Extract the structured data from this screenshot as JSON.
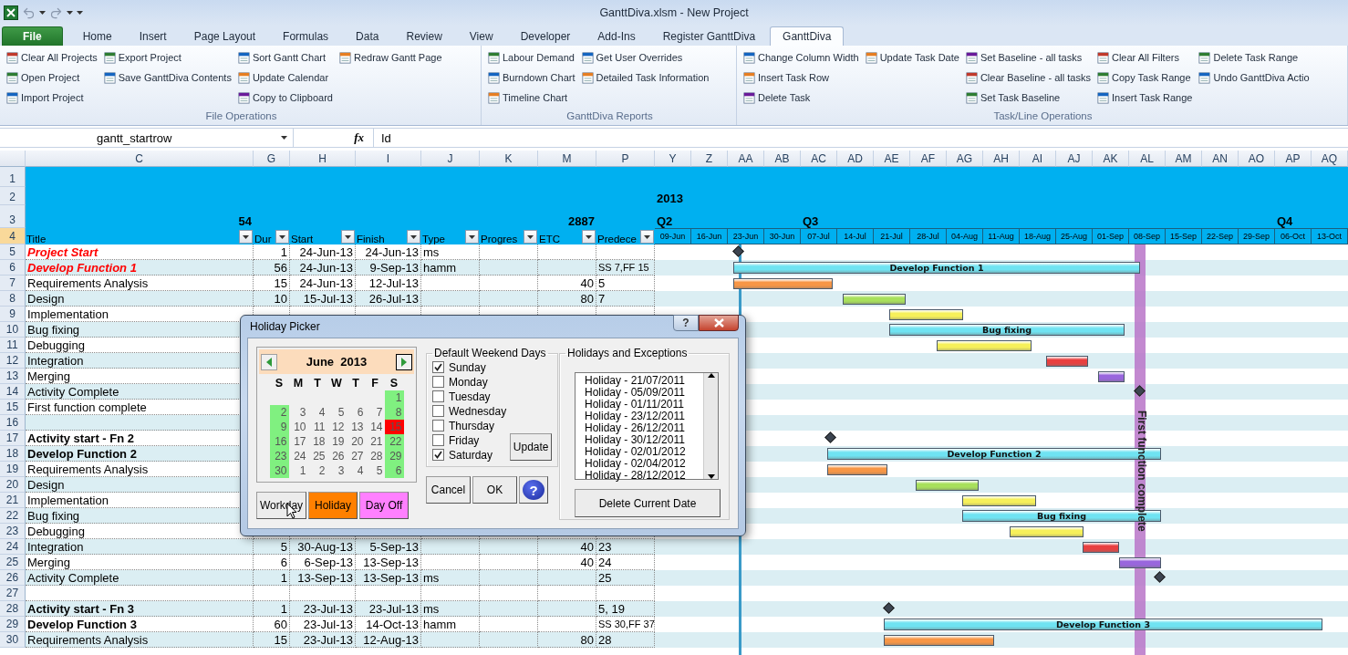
{
  "window": {
    "title": "GanttDiva.xlsm - New Project"
  },
  "tabs": [
    {
      "label": "File",
      "kind": "file",
      "selected": false
    },
    {
      "label": "Home",
      "kind": "tab",
      "selected": false
    },
    {
      "label": "Insert",
      "kind": "tab",
      "selected": false
    },
    {
      "label": "Page Layout",
      "kind": "tab",
      "selected": false
    },
    {
      "label": "Formulas",
      "kind": "tab",
      "selected": false
    },
    {
      "label": "Data",
      "kind": "tab",
      "selected": false
    },
    {
      "label": "Review",
      "kind": "tab",
      "selected": false
    },
    {
      "label": "View",
      "kind": "tab",
      "selected": false
    },
    {
      "label": "Developer",
      "kind": "tab",
      "selected": false
    },
    {
      "label": "Add-Ins",
      "kind": "tab",
      "selected": false
    },
    {
      "label": "Register GanttDiva",
      "kind": "tab",
      "selected": false
    },
    {
      "label": "GanttDiva",
      "kind": "tab",
      "selected": true
    }
  ],
  "ribbon": {
    "groups": [
      {
        "label": "File Operations",
        "columns": [
          [
            "Clear All Projects",
            "Open Project",
            "Import Project"
          ],
          [
            "Export Project",
            "Save GanttDiva Contents"
          ],
          [
            "Sort Gantt Chart",
            "Update Calendar",
            "Copy to Clipboard"
          ],
          [
            "Redraw Gantt Page"
          ]
        ]
      },
      {
        "label": "GanttDiva Reports",
        "columns": [
          [
            "Labour Demand",
            "Burndown Chart",
            "Timeline Chart"
          ],
          [
            "Get User Overrides",
            "Detailed Task Information"
          ]
        ]
      },
      {
        "label": "Task/Line Operations",
        "columns": [
          [
            "Change Column Width",
            "Insert Task Row",
            "Delete Task"
          ],
          [
            "Update Task Date"
          ],
          [
            "Set Baseline - all tasks",
            "Clear Baseline - all tasks",
            "Set Task Baseline"
          ],
          [
            "Clear All Filters",
            "Copy Task Range",
            "Insert Task Range"
          ],
          [
            "Delete Task Range",
            "Undo GanttDiva Actio"
          ]
        ]
      }
    ]
  },
  "formula_bar": {
    "name_box": "gantt_startrow",
    "fx": "fx",
    "value": "Id"
  },
  "sheet": {
    "columns": [
      "C",
      "G",
      "H",
      "I",
      "J",
      "K",
      "M",
      "P"
    ],
    "header_rows": [
      {
        "n": "1",
        "selected": false
      },
      {
        "n": "2",
        "selected": false
      },
      {
        "n": "3",
        "selected": false
      },
      {
        "n": "4",
        "selected": true
      }
    ],
    "totals": {
      "title": "54",
      "etc": "2887"
    },
    "headers": [
      "Title",
      "Dur",
      "Start",
      "Finish",
      "Type",
      "Progres",
      "ETC",
      "Predece"
    ],
    "rows": [
      {
        "n": "5",
        "kind": "red",
        "selected": false,
        "title": "Project Start",
        "dur": "1",
        "start": "24-Jun-13",
        "finish": "24-Jun-13",
        "type": "ms"
      },
      {
        "n": "6",
        "kind": "red",
        "selected": false,
        "title": "Develop Function 1",
        "dur": "56",
        "start": "24-Jun-13",
        "finish": "9-Sep-13",
        "type": "hamm",
        "pred": "SS 7,FF 15"
      },
      {
        "n": "7",
        "kind": "normal",
        "selected": false,
        "title": "Requirements Analysis",
        "dur": "15",
        "start": "24-Jun-13",
        "finish": "12-Jul-13",
        "etc": "40",
        "pred": "5"
      },
      {
        "n": "8",
        "kind": "normal",
        "selected": false,
        "title": "Design",
        "dur": "10",
        "start": "15-Jul-13",
        "finish": "26-Jul-13",
        "etc": "80",
        "pred": "7"
      },
      {
        "n": "9",
        "kind": "normal",
        "selected": false,
        "title": "Implementation"
      },
      {
        "n": "10",
        "kind": "normal",
        "selected": false,
        "title": "Bug fixing"
      },
      {
        "n": "11",
        "kind": "normal",
        "selected": false,
        "title": "Debugging"
      },
      {
        "n": "12",
        "kind": "normal",
        "selected": false,
        "title": "Integration"
      },
      {
        "n": "13",
        "kind": "normal",
        "selected": false,
        "title": "Merging"
      },
      {
        "n": "14",
        "kind": "normal",
        "selected": false,
        "title": "Activity Complete"
      },
      {
        "n": "15",
        "kind": "normal",
        "selected": false,
        "title": "First function complete"
      },
      {
        "n": "16",
        "selected": false
      },
      {
        "n": "17",
        "kind": "bold",
        "selected": false,
        "title": "Activity start - Fn 2"
      },
      {
        "n": "18",
        "kind": "bold",
        "selected": false,
        "title": "Develop Function 2"
      },
      {
        "n": "19",
        "kind": "normal",
        "selected": false,
        "title": "Requirements Analysis"
      },
      {
        "n": "20",
        "kind": "normal",
        "selected": false,
        "title": "Design"
      },
      {
        "n": "21",
        "kind": "normal",
        "selected": false,
        "title": "Implementation"
      },
      {
        "n": "22",
        "kind": "normal",
        "selected": false,
        "title": "Bug fixing"
      },
      {
        "n": "23",
        "kind": "normal",
        "selected": false,
        "title": "Debugging"
      },
      {
        "n": "24",
        "kind": "normal",
        "selected": false,
        "title": "Integration",
        "dur": "5",
        "start": "30-Aug-13",
        "finish": "5-Sep-13",
        "etc": "40",
        "pred": "23"
      },
      {
        "n": "25",
        "kind": "normal",
        "selected": false,
        "title": "Merging",
        "dur": "6",
        "start": "6-Sep-13",
        "finish": "13-Sep-13",
        "etc": "40",
        "pred": "24"
      },
      {
        "n": "26",
        "kind": "normal",
        "selected": false,
        "title": "Activity Complete",
        "dur": "1",
        "start": "13-Sep-13",
        "finish": "13-Sep-13",
        "type": "ms",
        "pred": "25"
      },
      {
        "n": "27",
        "selected": false
      },
      {
        "n": "28",
        "kind": "bold",
        "selected": false,
        "title": "Activity start - Fn 3",
        "dur": "1",
        "start": "23-Jul-13",
        "finish": "23-Jul-13",
        "type": "ms",
        "pred": "5, 19"
      },
      {
        "n": "29",
        "kind": "bold",
        "selected": false,
        "title": "Develop Function 3",
        "dur": "60",
        "start": "23-Jul-13",
        "finish": "14-Oct-13",
        "type": "hamm",
        "pred": "SS 30,FF 37"
      },
      {
        "n": "30",
        "kind": "normal",
        "selected": false,
        "title": "Requirements Analysis",
        "dur": "15",
        "start": "23-Jul-13",
        "finish": "12-Aug-13",
        "etc": "80",
        "pred": "28"
      }
    ]
  },
  "gantt": {
    "columns": [
      "Y",
      "Z",
      "AA",
      "AB",
      "AC",
      "AD",
      "AE",
      "AF",
      "AG",
      "AH",
      "AI",
      "AJ",
      "AK",
      "AL",
      "AM",
      "AN",
      "AO",
      "AP",
      "AQ"
    ],
    "year": "2013",
    "quarters": [
      "Q2",
      "Q3",
      "Q4"
    ],
    "weeks": [
      "09-Jun",
      "16-Jun",
      "23-Jun",
      "30-Jun",
      "07-Jul",
      "14-Jul",
      "21-Jul",
      "28-Jul",
      "04-Aug",
      "11-Aug",
      "18-Aug",
      "25-Aug",
      "01-Sep",
      "08-Sep",
      "15-Sep",
      "22-Sep",
      "29-Sep",
      "06-Oct",
      "13-Oct"
    ],
    "bars": [
      {
        "kind": "milestone"
      },
      {
        "kind": "summary",
        "color": "#6fe3f2",
        "label": "Develop Function 1"
      },
      {
        "kind": "bar",
        "color": "#f79646"
      },
      {
        "kind": "bar",
        "color": "#a8e05c"
      },
      {
        "kind": "bar",
        "color": "#f6f05a"
      },
      {
        "kind": "summary",
        "color": "#6fe3f2",
        "label": "Bug fixing"
      },
      {
        "kind": "bar",
        "color": "#f6f05a"
      },
      {
        "kind": "bar",
        "color": "#e84040"
      },
      {
        "kind": "bar",
        "color": "#9966dd"
      },
      {
        "kind": "milestone"
      },
      {
        "kind": "milestone"
      },
      {
        "kind": "summary",
        "color": "#6fe3f2",
        "label": "Develop Function 2"
      },
      {
        "kind": "bar",
        "color": "#f79646"
      },
      {
        "kind": "bar",
        "color": "#a8e05c"
      },
      {
        "kind": "bar",
        "color": "#f6f05a"
      },
      {
        "kind": "summary",
        "color": "#6fe3f2",
        "label": "Bug fixing"
      },
      {
        "kind": "bar",
        "color": "#f6f05a"
      },
      {
        "kind": "bar",
        "color": "#e84040"
      },
      {
        "kind": "bar",
        "color": "#9966dd"
      },
      {
        "kind": "milestone"
      },
      {
        "kind": "milestone"
      },
      {
        "kind": "summary",
        "color": "#6fe3f2",
        "label": "Develop Function 3"
      },
      {
        "kind": "bar",
        "color": "#f79646"
      }
    ],
    "markers": [
      {
        "kind": "today"
      },
      {
        "kind": "milestone-line",
        "label": "First function complete"
      }
    ]
  },
  "dialog": {
    "title": "Holiday Picker",
    "title_help": "?",
    "calendar": {
      "month": "June  2013",
      "weekdays": [
        "S",
        "M",
        "T",
        "W",
        "T",
        "F",
        "S"
      ],
      "weeks": [
        [
          {
            "d": "1",
            "kind": "weekend"
          }
        ],
        [
          {
            "d": "2",
            "kind": "weekend"
          },
          {
            "d": "3",
            "kind": "day"
          },
          {
            "d": "4",
            "kind": "day"
          },
          {
            "d": "5",
            "kind": "day"
          },
          {
            "d": "6",
            "kind": "day"
          },
          {
            "d": "7",
            "kind": "day"
          },
          {
            "d": "8",
            "kind": "weekend"
          }
        ],
        [
          {
            "d": "9",
            "kind": "weekend"
          },
          {
            "d": "10",
            "kind": "day"
          },
          {
            "d": "11",
            "kind": "day"
          },
          {
            "d": "12",
            "kind": "day"
          },
          {
            "d": "13",
            "kind": "day"
          },
          {
            "d": "14",
            "kind": "day"
          },
          {
            "d": "15",
            "kind": "holiday"
          }
        ],
        [
          {
            "d": "16",
            "kind": "weekend"
          },
          {
            "d": "17",
            "kind": "day"
          },
          {
            "d": "18",
            "kind": "day"
          },
          {
            "d": "19",
            "kind": "day"
          },
          {
            "d": "20",
            "kind": "day"
          },
          {
            "d": "21",
            "kind": "day"
          },
          {
            "d": "22",
            "kind": "weekend"
          }
        ],
        [
          {
            "d": "23",
            "kind": "weekend"
          },
          {
            "d": "24",
            "kind": "day"
          },
          {
            "d": "25",
            "kind": "day"
          },
          {
            "d": "26",
            "kind": "day"
          },
          {
            "d": "27",
            "kind": "day"
          },
          {
            "d": "28",
            "kind": "day"
          },
          {
            "d": "29",
            "kind": "weekend"
          }
        ],
        [
          {
            "d": "30",
            "kind": "weekend"
          },
          {
            "d": "1",
            "kind": "other"
          },
          {
            "d": "2",
            "kind": "other"
          },
          {
            "d": "3",
            "kind": "other"
          },
          {
            "d": "4",
            "kind": "other"
          },
          {
            "d": "5",
            "kind": "other"
          },
          {
            "d": "6",
            "kind": "weekend"
          }
        ]
      ]
    },
    "day_buttons": [
      {
        "label": "Workday",
        "color": "#ececec"
      },
      {
        "label": "Holiday",
        "color": "#ff8000"
      },
      {
        "label": "Day Off",
        "color": "#ff80ff"
      }
    ],
    "weekend_group": {
      "label": "Default Weekend Days",
      "days": [
        {
          "label": "Sunday",
          "checked": true
        },
        {
          "label": "Monday",
          "checked": false
        },
        {
          "label": "Tuesday",
          "checked": false
        },
        {
          "label": "Wednesday",
          "checked": false
        },
        {
          "label": "Thursday",
          "checked": false
        },
        {
          "label": "Friday",
          "checked": false
        },
        {
          "label": "Saturday",
          "checked": true
        }
      ],
      "update": "Update"
    },
    "actions": [
      "Cancel",
      "OK"
    ],
    "help": "?",
    "holidays_group": {
      "label": "Holidays and Exceptions",
      "items": [
        "Holiday - 21/07/2011",
        "Holiday - 05/09/2011",
        "Holiday - 01/11/2011",
        "Holiday - 23/12/2011",
        "Holiday - 26/12/2011",
        "Holiday - 30/12/2011",
        "Holiday - 02/01/2012",
        "Holiday - 02/04/2012",
        "Holiday - 28/12/2012"
      ],
      "delete": "Delete Current Date"
    }
  }
}
